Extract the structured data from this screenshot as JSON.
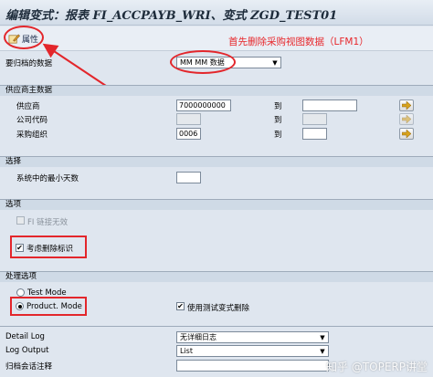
{
  "window": {
    "title": "编辑变式：报表 FI_ACCPAYB_WRI、变式 ZGD_TEST01"
  },
  "toolbar": {
    "attributes_label": "属性"
  },
  "annotation": {
    "text": "首先删除采购视图数据（LFM1）",
    "color": "#e3262b"
  },
  "data_to_archive": {
    "label": "要归档的数据",
    "value": "MM MM 数据"
  },
  "vendor_master": {
    "heading": "供应商主数据",
    "to_label": "到",
    "rows": [
      {
        "label": "供应商",
        "from": "7000000000",
        "to": "",
        "enabled": true
      },
      {
        "label": "公司代码",
        "from": "",
        "to": "",
        "enabled": false
      },
      {
        "label": "采购组织",
        "from": "0006",
        "to": "",
        "enabled": true
      }
    ]
  },
  "selection": {
    "heading": "选择",
    "min_days_label": "系统中的最小天数",
    "min_days_value": ""
  },
  "options": {
    "heading": "选项",
    "fi_link_invalid_label": "FI 链接无效",
    "consider_deletion_flag_label": "考虑删除标识",
    "consider_deletion_flag_checked": true
  },
  "processing_options": {
    "heading": "处理选项",
    "test_mode_label": "Test Mode",
    "production_mode_label": "Product. Mode",
    "selected": "production",
    "use_test_variant_delete_label": "使用测试变式删除",
    "use_test_variant_delete_checked": true
  },
  "bottom_fields": {
    "detail_log_label": "Detail Log",
    "detail_log_value": "无详细日志",
    "log_output_label": "Log Output",
    "log_output_value": "List",
    "archive_note_label": "归档会话注释",
    "archive_note_value": ""
  },
  "watermark": "知乎 @TOPERP讲堂"
}
